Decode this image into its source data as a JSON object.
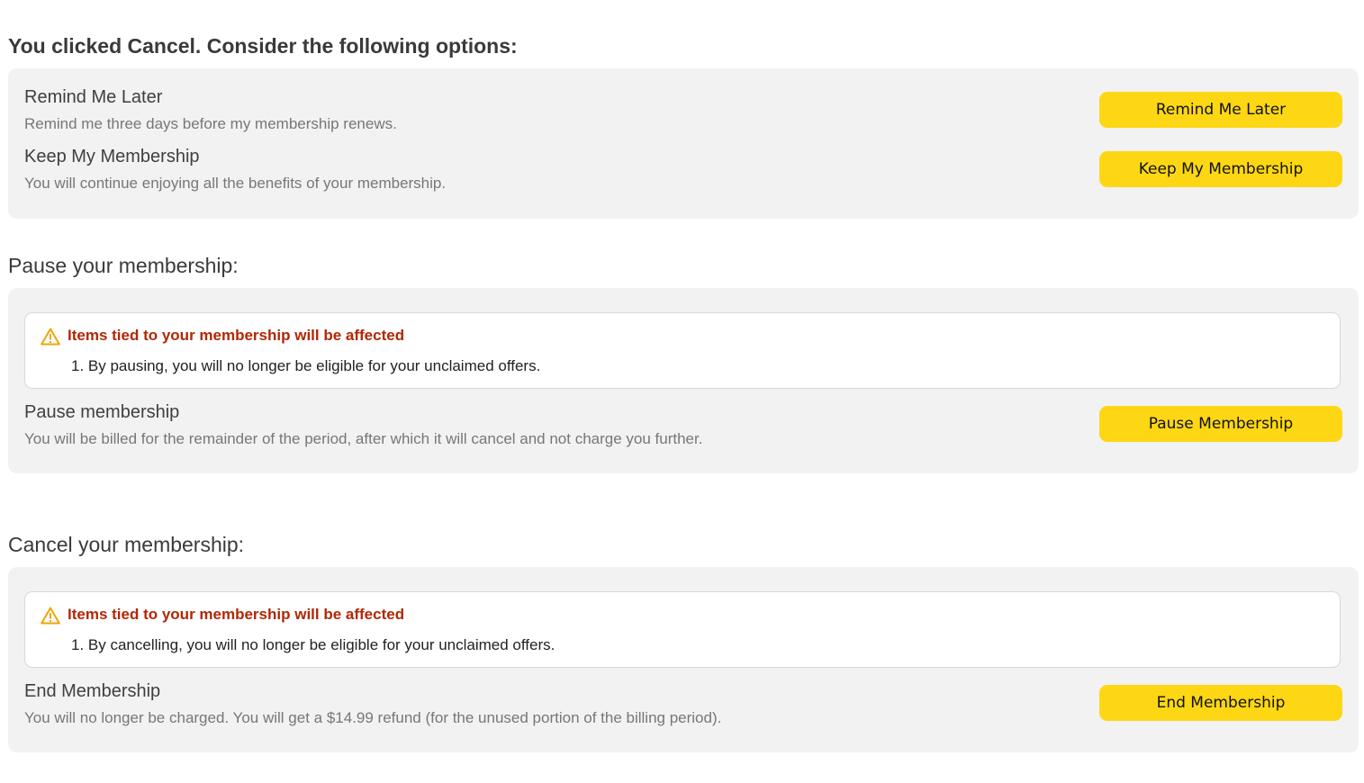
{
  "header": {
    "title": "You clicked Cancel. Consider the following options:"
  },
  "options": {
    "remind": {
      "title": "Remind Me Later",
      "description": "Remind me three days before my membership renews.",
      "button_label": "Remind Me Later"
    },
    "keep": {
      "title": "Keep My Membership",
      "description": "You will continue enjoying all the benefits of your membership.",
      "button_label": "Keep My Membership"
    }
  },
  "pause_section": {
    "heading": "Pause your membership:",
    "warning": {
      "icon": "warning-triangle-icon",
      "title": "Items tied to your membership will be affected",
      "items": [
        "1. By pausing, you will no longer be eligible for your unclaimed offers."
      ]
    },
    "option": {
      "title": "Pause membership",
      "description": "You will be billed for the remainder of the period, after which it will cancel and not charge you further.",
      "button_label": "Pause Membership"
    }
  },
  "cancel_section": {
    "heading": "Cancel your membership:",
    "warning": {
      "icon": "warning-triangle-icon",
      "title": "Items tied to your membership will be affected",
      "items": [
        "1. By cancelling, you will no longer be eligible for your unclaimed offers."
      ]
    },
    "option": {
      "title": "End Membership",
      "description": "You will no longer be charged. You will get a $14.99 refund (for the unused portion of the billing period).",
      "button_label": "End Membership"
    }
  },
  "colors": {
    "button_background": "#fdd714",
    "panel_background": "#f2f2f2",
    "warning_title": "#b12704",
    "warning_icon": "#f0a30a"
  }
}
